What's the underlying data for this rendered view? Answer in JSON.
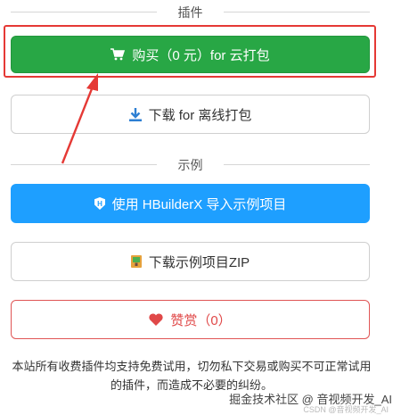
{
  "sections": {
    "plugin_label": "插件",
    "example_label": "示例"
  },
  "buttons": {
    "buy": {
      "label": "购买（0 元）for 云打包",
      "icon": "cart-icon"
    },
    "offline": {
      "label": "下载 for 离线打包",
      "icon": "download-icon"
    },
    "hbuilder": {
      "label": "使用 HBuilderX 导入示例项目",
      "icon": "hbuilderx-icon"
    },
    "zip": {
      "label": "下载示例项目ZIP",
      "icon": "zip-file-icon"
    },
    "reward": {
      "label": "赞赏（0）",
      "icon": "heart-icon"
    }
  },
  "notice": "本站所有收费插件均支持免费试用，切勿私下交易或购买不可正常试用的插件，而造成不必要的纠纷。",
  "watermark": {
    "main": "掘金技术社区 @ 音视频开发_AI",
    "sub": "CSDN @音视频开发_AI"
  },
  "colors": {
    "buy_green": "#28a745",
    "hbuilder_blue": "#1e9fff",
    "reward_red": "#e04848",
    "annotation_red": "#e53935"
  }
}
